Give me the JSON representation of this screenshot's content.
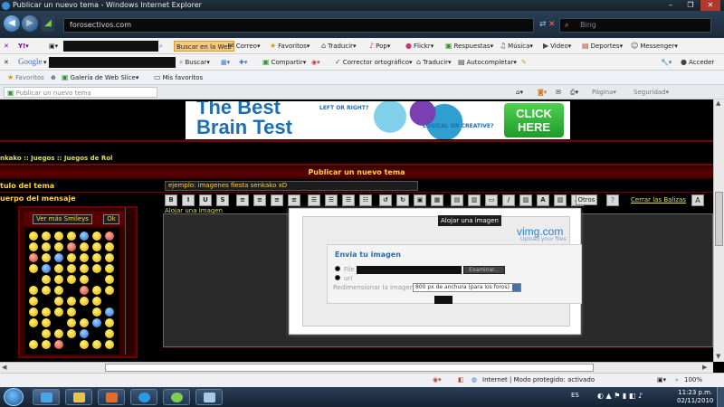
{
  "window": {
    "title": "Publicar un nuevo tema - Windows Internet Explorer"
  },
  "addressbar": {
    "url": "forosectivos.com",
    "search_placeholder": "Bing"
  },
  "yahoo_toolbar": {
    "search_button": "Buscar en la Web",
    "items": [
      "Correo",
      "Favoritos",
      "Traducir",
      "Pop",
      "Flickr",
      "Respuestas",
      "Música",
      "Video",
      "Deportes",
      "Messenger"
    ]
  },
  "google_toolbar": {
    "logo": "Google",
    "search_button": "Buscar",
    "items": [
      "Compartir",
      "Corrector ortográfico",
      "Traducir",
      "Autocompletar"
    ],
    "signin": "Acceder"
  },
  "favorites_bar": {
    "favorites": "Favoritos",
    "web_slice": "Galería de Web Slice",
    "mis_favoritos": "Mis favoritos"
  },
  "tab": {
    "label": "Publicar un nuevo tema",
    "pagina": "Página",
    "seguridad": "Seguridad"
  },
  "banner": {
    "line1": "The Best",
    "line2": "Brain Test",
    "left_right": "LEFT OR RIGHT?",
    "logical_creative": "LOGICAL OR CREATIVE?",
    "cta": "CLICK HERE"
  },
  "forum": {
    "breadcrumb": "nkako  :: Juegos :: Juegos de Rol",
    "header": "Publicar un nuevo tema",
    "subject_label": "tulo del tema",
    "subject_value": "ejemplo: imagenes fiesta senkako xD",
    "body_label": "uerpo del mensaje",
    "more_smileys": "Ver más Smileys",
    "ok": "Ok",
    "upload_link": "Alojar una Imagen",
    "otros": "Otros",
    "close_tags": "Cerrar las Balizas"
  },
  "editor_buttons": [
    "B",
    "I",
    "U",
    "S",
    "≡",
    "≡",
    "≡",
    "≡",
    "☰",
    "☰",
    "☰",
    "☷",
    "↺",
    "↻",
    "▣",
    "▦",
    "▤",
    "▥",
    "▭",
    "/",
    "▨",
    "A",
    "▧",
    "A"
  ],
  "dialog": {
    "tooltip": "Alojar una imagen",
    "logo": "vimg.com",
    "logo_sub": "Upload your files",
    "title": "Envia tu imagen",
    "file_label": "File",
    "browse": "Examinar...",
    "url_label": "url",
    "resize_label": "Redimensionar la imagen",
    "resize_value": "800 px de anchura (para los foros)"
  },
  "status": {
    "zone": "Internet | Modo protegido: activado",
    "zoom": "100%"
  },
  "taskbar": {
    "lang": "ES",
    "time": "11:23 p.m.",
    "date": "02/11/2010"
  },
  "colors": {
    "forum_accent": "#ffd23a",
    "forum_bg": "#000000",
    "header_red": "#5e0000"
  }
}
